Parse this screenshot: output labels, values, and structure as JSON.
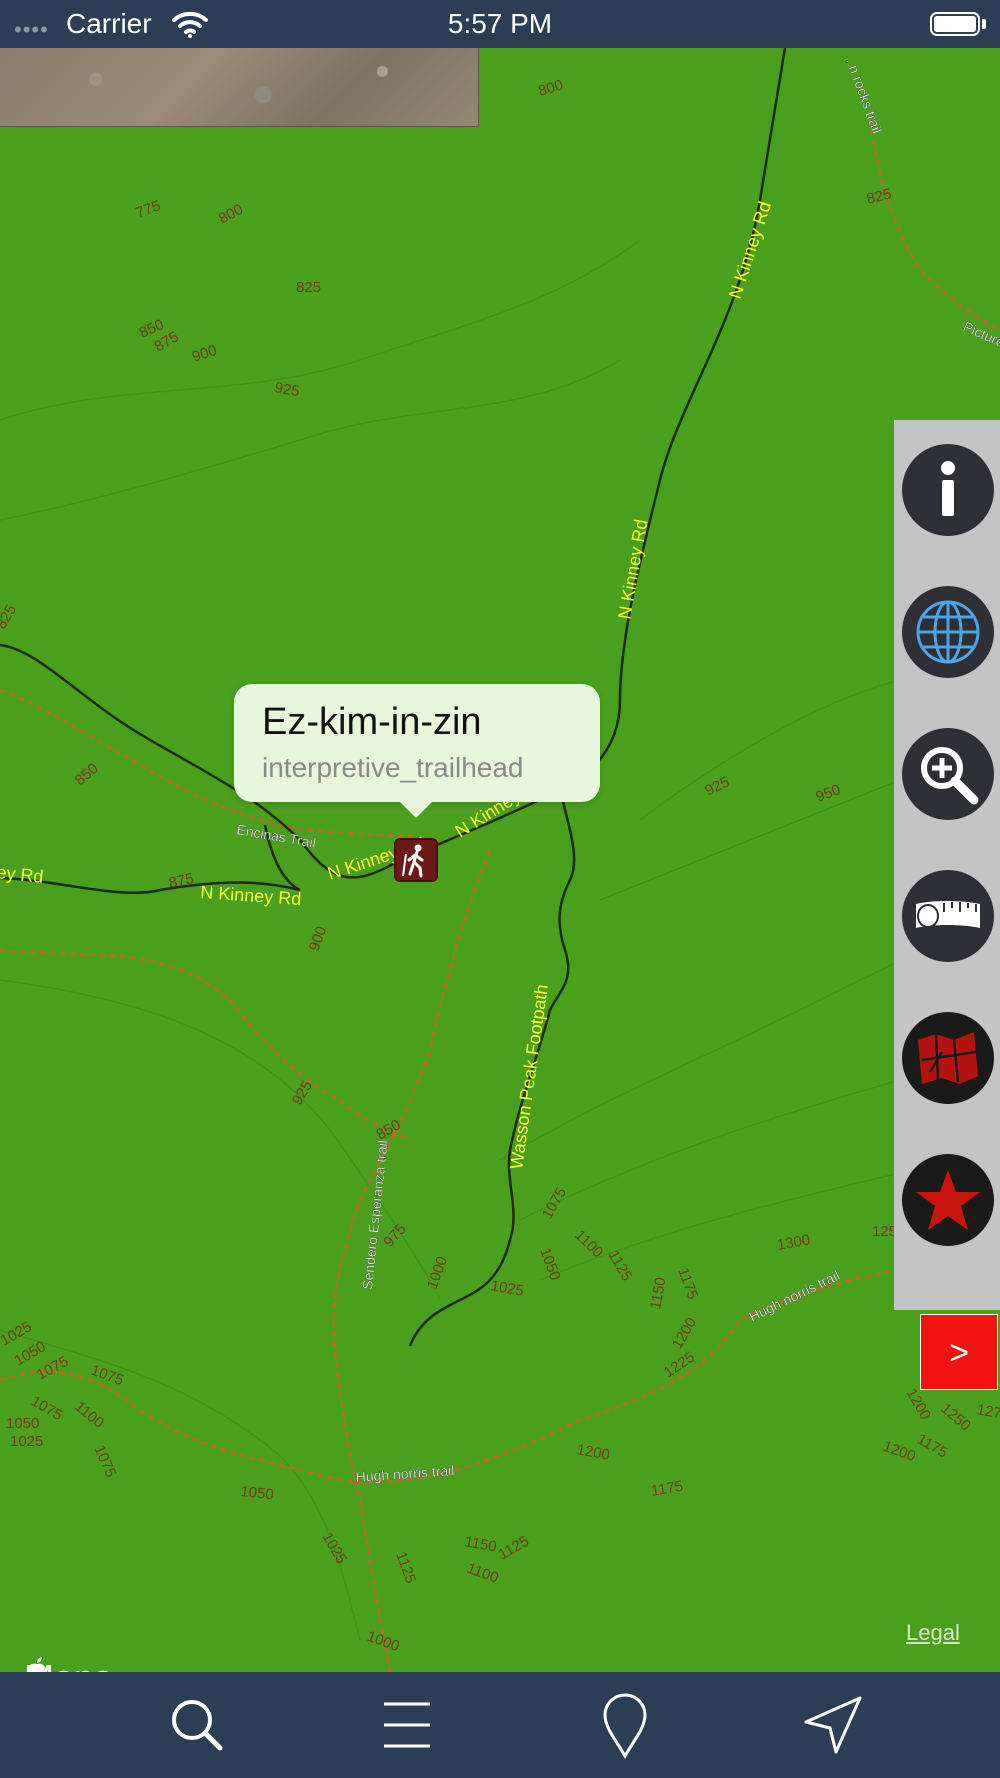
{
  "status_bar": {
    "signal": "••••",
    "carrier": "Carrier",
    "time": "5:57 PM"
  },
  "map": {
    "roads": [
      {
        "label": "N Kinney Rd"
      },
      {
        "label": "N Kinney Rd"
      },
      {
        "label": "N Kinney Rd"
      },
      {
        "label": "N Kinney Rd"
      },
      {
        "label": "N Kinney Rd"
      },
      {
        "label": "ey Rd"
      },
      {
        "label": "Wasson Peak Footpath"
      }
    ],
    "trails": [
      {
        "label": "Encinas Trail"
      },
      {
        "label": "Sendero Esperanza trail"
      },
      {
        "label": "Hugh norris trail"
      },
      {
        "label": "Hugh norris trail"
      },
      {
        "label": "Picture"
      },
      {
        "label": "..n rocks trail"
      }
    ],
    "contour_labels": [
      "800",
      "775",
      "800",
      "825",
      "850",
      "875",
      "900",
      "925",
      "825",
      "825",
      "850",
      "925",
      "875",
      "900",
      "925",
      "850",
      "925",
      "950",
      "975",
      "1000",
      "1025",
      "1075",
      "1050",
      "1100",
      "1125",
      "1150",
      "1175",
      "1200",
      "1225",
      "1200",
      "1175",
      "1300",
      "1125",
      "1025",
      "1050",
      "1075",
      "1075",
      "1100",
      "1075",
      "1050",
      "1025",
      "1050",
      "1025",
      "1075",
      "1150",
      "1100",
      "1125",
      "1000",
      "1200",
      "1175",
      "1200",
      "1250",
      "127",
      "125"
    ]
  },
  "callout": {
    "title": "Ez-kim-in-zin",
    "subtitle": "interpretive_trailhead"
  },
  "trailhead_icon": "hiker-icon",
  "toolbar": {
    "tools": [
      {
        "name": "info-icon"
      },
      {
        "name": "globe-icon"
      },
      {
        "name": "zoom-in-icon"
      },
      {
        "name": "measure-tape-icon"
      },
      {
        "name": "map-layers-icon"
      },
      {
        "name": "star-icon"
      }
    ],
    "collapse_label": ">"
  },
  "attribution": {
    "logo_text": "Maps",
    "legal": "Legal"
  },
  "tab_bar": {
    "tabs": [
      {
        "name": "search-icon"
      },
      {
        "name": "menu-icon"
      },
      {
        "name": "pin-icon"
      },
      {
        "name": "location-arrow-icon"
      }
    ]
  },
  "colors": {
    "terrain": "#4aa01c",
    "road_label": "#ffff33",
    "trail": "#c0662b",
    "bars": "#2c3e55",
    "collapse_button": "#f31212"
  }
}
